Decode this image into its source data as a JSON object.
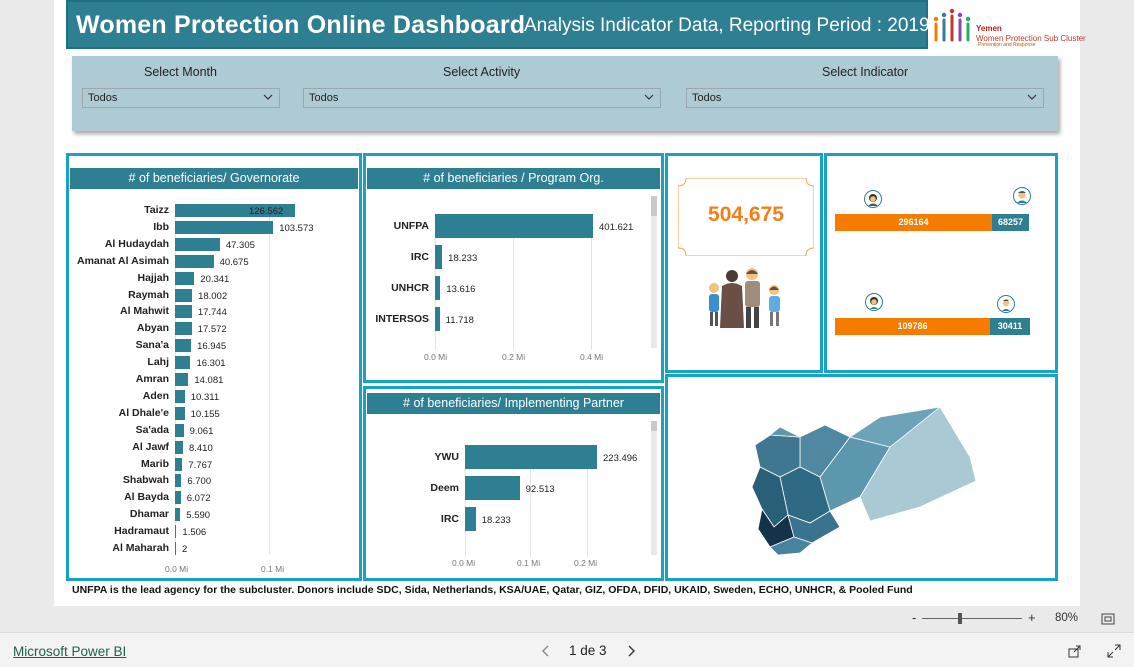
{
  "header": {
    "title": "Women Protection Online Dashboard",
    "subtitle": "Analysis Indicator Data, Reporting Period : 2019"
  },
  "brand": {
    "line1": "Yemen",
    "line2": "Women Protection Sub Cluster",
    "line3": "Prevention and Response"
  },
  "filters": [
    {
      "label": "Select Month",
      "value": "Todos"
    },
    {
      "label": "Select Activity",
      "value": "Todos"
    },
    {
      "label": "Select Indicator",
      "value": "Todos"
    }
  ],
  "governorate_panel": {
    "title": "# of beneficiaries/ Governorate",
    "ticks": [
      "0.0 Mi",
      "0.1 Mi"
    ]
  },
  "program_panel": {
    "title": "# of beneficiaries / Program Org.",
    "ticks": [
      "0.0 Mi",
      "0.2 Mi",
      "0.4 Mi"
    ]
  },
  "partner_panel": {
    "title": "# of beneficiaries/ Implementing Partner",
    "ticks": [
      "0.0 Mi",
      "0.1 Mi",
      "0.2 Mi"
    ]
  },
  "total": {
    "value": "504,675"
  },
  "gender_bars": [
    {
      "left": "296164",
      "right": "68257"
    },
    {
      "left": "109786",
      "right": "30411"
    }
  ],
  "footnote": "UNFPA is the lead agency for the subcluster. Donors include SDC,  Sida, Netherlands, KSA/UAE, Qatar, GIZ, OFDA, DFID, UKAID, Sweden, ECHO, UNHCR, & Pooled Fund",
  "zoom": {
    "minus": "-",
    "plus": "+",
    "level": "80%"
  },
  "footer": {
    "link": "Microsoft Power BI",
    "page": "1 de 3"
  },
  "colors": {
    "teal": "#2f7f93",
    "orange": "#f57c00",
    "panel_border": "#18a3c3"
  },
  "chart_data": [
    {
      "type": "bar",
      "title": "# of beneficiaries/ Governorate",
      "categories": [
        "Taizz",
        "Ibb",
        "Al Hudaydah",
        "Amanat Al Asimah",
        "Hajjah",
        "Raymah",
        "Al Mahwit",
        "Abyan",
        "Sana'a",
        "Lahj",
        "Amran",
        "Aden",
        "Al Dhale'e",
        "Sa'ada",
        "Al Jawf",
        "Marib",
        "Shabwah",
        "Al Bayda",
        "Dhamar",
        "Hadramaut",
        "Al Maharah"
      ],
      "values": [
        126562,
        103573,
        47305,
        40675,
        20341,
        18002,
        17744,
        17572,
        16945,
        16301,
        14081,
        10311,
        10155,
        9061,
        8410,
        7767,
        6700,
        6072,
        5590,
        1506,
        2
      ],
      "labels": [
        "126.562",
        "103.573",
        "47.305",
        "40.675",
        "20.341",
        "18.002",
        "17.744",
        "17.572",
        "16.945",
        "16.301",
        "14.081",
        "10.311",
        "10.155",
        "9.061",
        "8.410",
        "7.767",
        "6.700",
        "6.072",
        "5.590",
        "1.506",
        "2"
      ],
      "xlim": [
        0,
        0.1
      ]
    },
    {
      "type": "bar",
      "title": "# of beneficiaries / Program Org.",
      "categories": [
        "UNFPA",
        "IRC",
        "UNHCR",
        "INTERSOS"
      ],
      "values": [
        401621,
        18233,
        13616,
        11718
      ],
      "labels": [
        "401.621",
        "18.233",
        "13.616",
        "11.718"
      ],
      "xlim": [
        0,
        0.4
      ]
    },
    {
      "type": "bar",
      "title": "# of beneficiaries/ Implementing Partner",
      "categories": [
        "YWU",
        "Deem",
        "IRC"
      ],
      "values": [
        223496,
        92513,
        18233
      ],
      "labels": [
        "223.496",
        "92.513",
        "18.233"
      ],
      "xlim": [
        0,
        0.2
      ]
    }
  ]
}
